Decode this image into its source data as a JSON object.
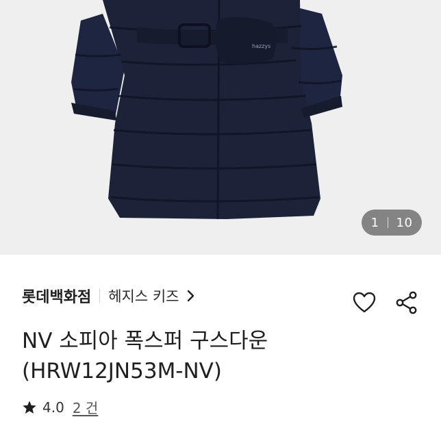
{
  "gallery": {
    "current": "1",
    "total": "10"
  },
  "product": {
    "store": "롯데백화점",
    "brand": "헤지스 키즈",
    "title_line1": "NV 소피아 폭스퍼 구스다운",
    "title_line2": "(HRW12JN53M-NV)",
    "rating": "4.0",
    "review_count": "2 건"
  },
  "icons": {
    "brand_link": "chevron-right-icon",
    "like": "heart-outline-icon",
    "share": "share-icon",
    "rating": "star-icon"
  },
  "colors": {
    "hero_bg": "#efefef",
    "coat": "#1c2238",
    "text": "#1f1f1f"
  }
}
